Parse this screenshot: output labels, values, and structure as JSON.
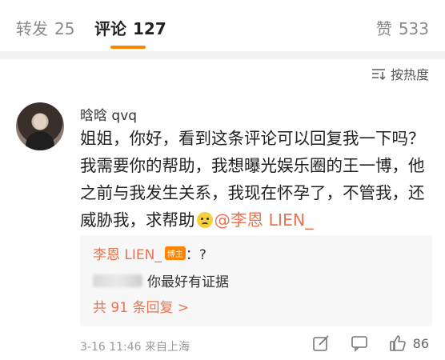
{
  "tabs": {
    "repost": {
      "label": "转发",
      "count": "25"
    },
    "comment": {
      "label": "评论",
      "count": "127"
    },
    "like": {
      "label": "赞",
      "count": "533"
    }
  },
  "sort": {
    "label": "按热度",
    "icon": "sort-icon"
  },
  "comment": {
    "username": "晗晗 qvq",
    "text_before_emoji": "姐姐，你好，看到这条评论可以回复我一下吗？我需要你的帮助，我想曝光娱乐圈的王一博，他之前与我发生关系，我现在怀孕了，不管我，还威胁我，求帮助",
    "emoji": "sad-face-emoji",
    "mention": "@李恩 LIEN_",
    "timestamp": "3-16 11:46",
    "location": "来自上海",
    "like_count": "86"
  },
  "replies": {
    "reply1_user": "李恩 LIEN_",
    "reply1_badge": "博主",
    "reply1_text": "：?",
    "reply2_text": "你最好有证据",
    "more_label": "共 91 条回复 >"
  },
  "colors": {
    "accent": "#ff8200",
    "link": "#eb7350",
    "muted": "#999999"
  }
}
